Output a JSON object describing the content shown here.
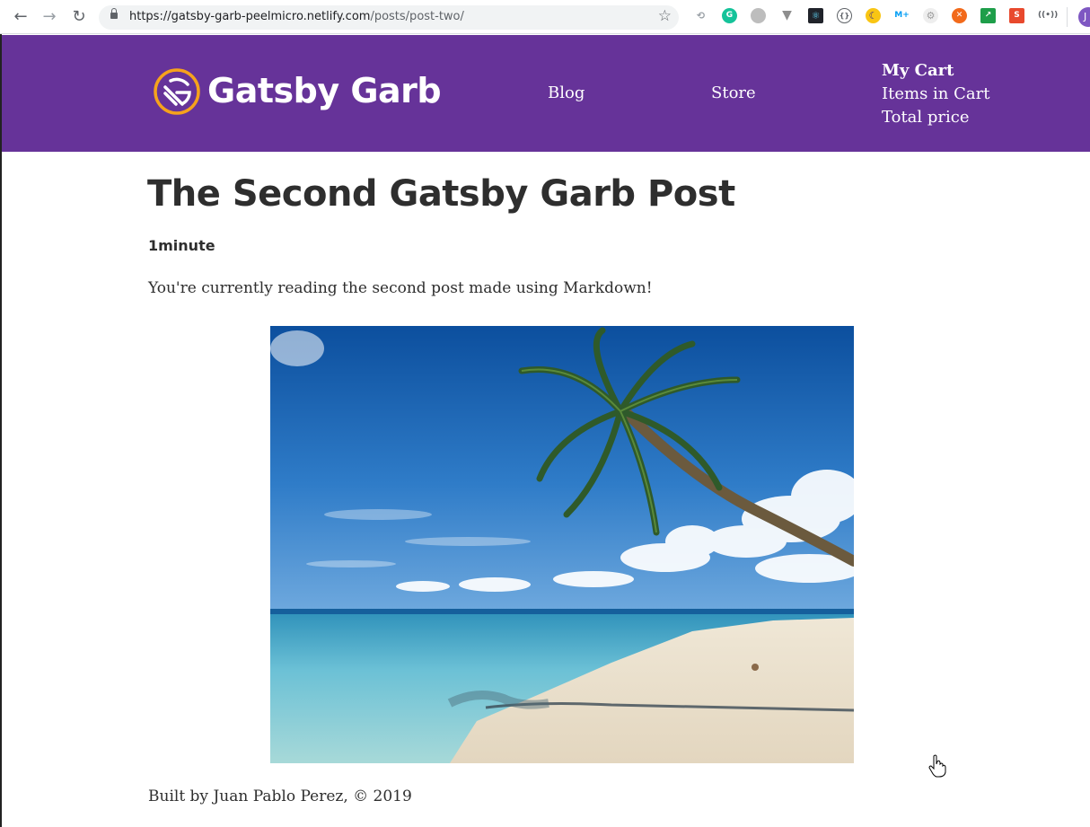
{
  "browser": {
    "url_host": "https://gatsby-garb-peelmicro.netlify.com",
    "url_path": "/posts/post-two/",
    "profile_initial": "J",
    "extensions": [
      {
        "icon": "lighthouse-icon",
        "color": "#9aa0a6"
      },
      {
        "icon": "grammarly-icon",
        "color": "#15c39a",
        "glyph": "G"
      },
      {
        "icon": "circle-ext-icon",
        "color": "#bdbdbd"
      },
      {
        "icon": "vue-devtools-icon",
        "color": "#8e8e8e"
      },
      {
        "icon": "react-devtools-icon",
        "color": "#20232a"
      },
      {
        "icon": "json-viewer-icon",
        "color": "#5f6368"
      },
      {
        "icon": "moon-ext-icon",
        "color": "#f9c513"
      },
      {
        "icon": "movistar-icon",
        "color": "#019df4",
        "glyph": "M+"
      },
      {
        "icon": "gear-ext-icon",
        "color": "#cfcfcf"
      },
      {
        "icon": "orange-ext-icon",
        "color": "#f26a1b"
      },
      {
        "icon": "green-arrow-icon",
        "color": "#1e9e4a"
      },
      {
        "icon": "redux-devtools-icon",
        "color": "#e8492d",
        "glyph": "S"
      },
      {
        "icon": "broadcast-icon",
        "color": "#5f6368"
      }
    ]
  },
  "header": {
    "logo_text": "Gatsby Garb",
    "nav": {
      "blog": "Blog",
      "store": "Store"
    },
    "cart": {
      "title": "My Cart",
      "items": "Items in Cart",
      "total": "Total price"
    },
    "colors": {
      "background": "#663399",
      "logo_ring": "#f6a21c"
    }
  },
  "post": {
    "title": "The Second Gatsby Garb Post",
    "read_time": "1minute",
    "body": "You're currently reading the second post made using Markdown!",
    "image_alt": "palm-tree-beach-photo"
  },
  "footer": {
    "text": "Built by Juan Pablo Perez, © 2019"
  }
}
